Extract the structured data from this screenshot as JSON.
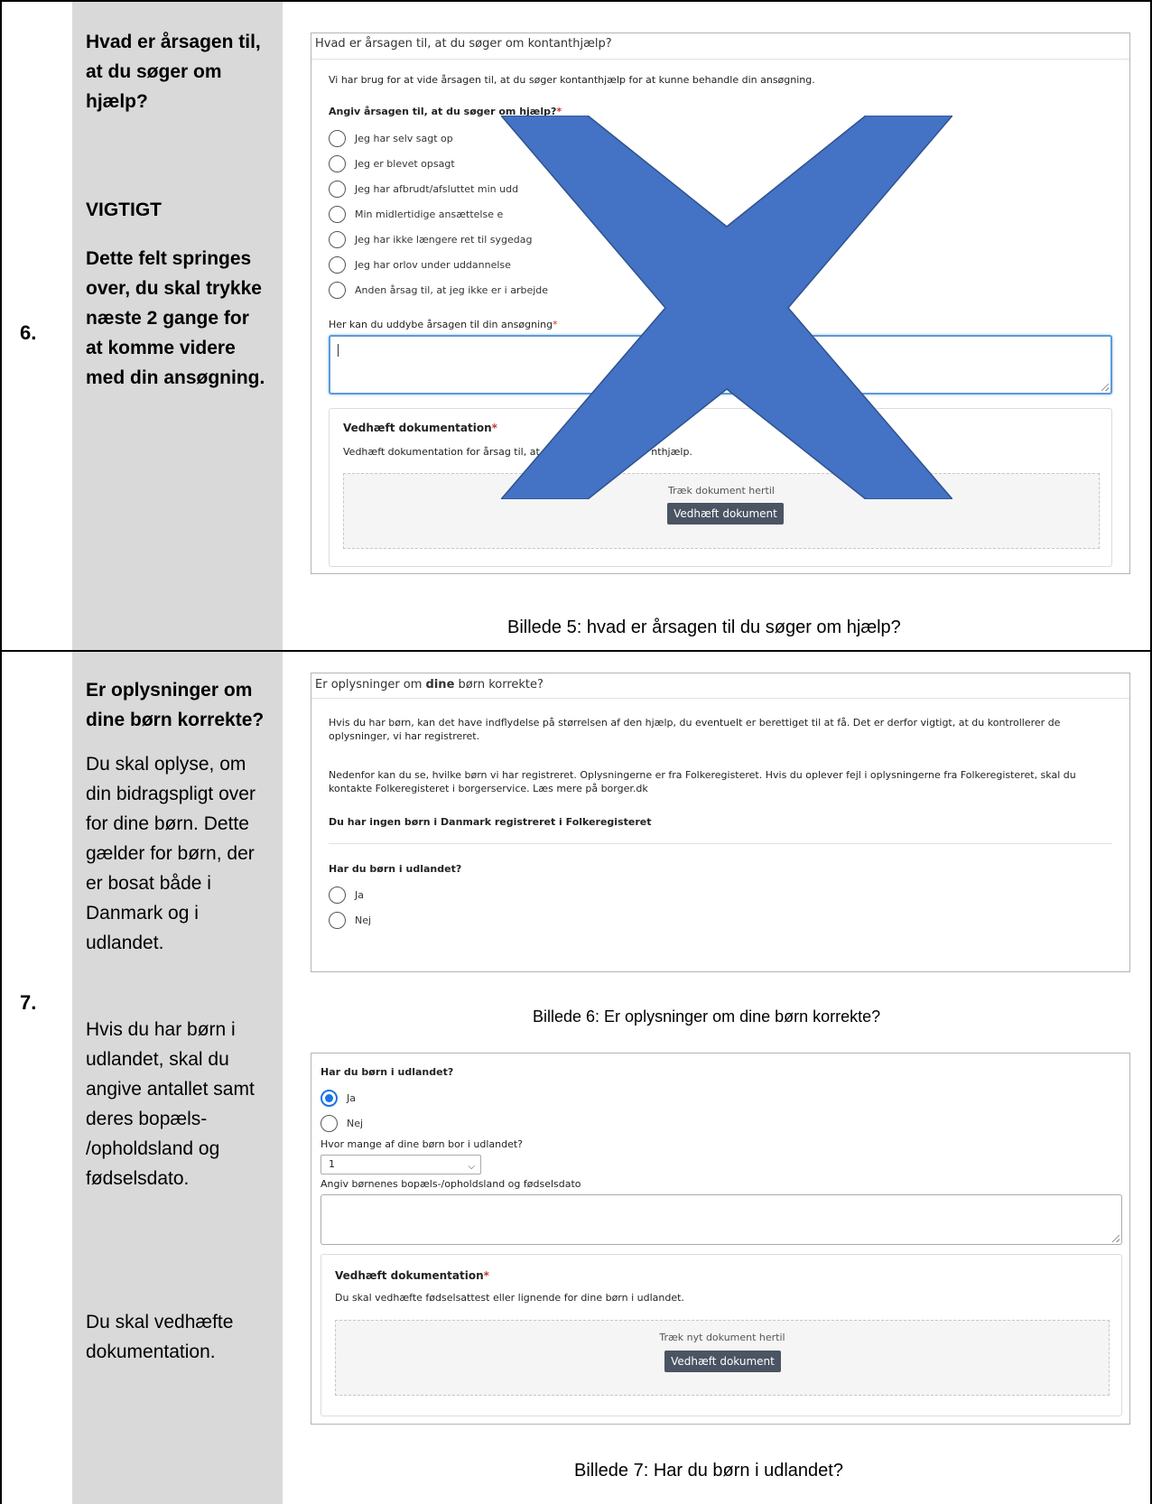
{
  "colors": {
    "cross": "#4472c4",
    "sidebar": "#d9d9d9",
    "accent": "#1a73e8",
    "button": "#4a5463",
    "required": "#c0392b"
  },
  "row6": {
    "number": "6.",
    "heading": [
      "Hvad er årsagen til,",
      "at du søger om",
      "hjælp?"
    ],
    "important": "VIGTIGT",
    "note": [
      "Dette felt springes",
      "over, du skal trykke",
      "næste 2 gange for",
      "at komme videre",
      "med din ansøgning."
    ],
    "caption": "Billede 5: hvad er årsagen til du søger om hjælp?",
    "screenshot": {
      "title": "Hvad er årsagen til, at du søger om kontanthjælp?",
      "intro": "Vi har brug for at vide årsagen til, at du søger kontanthjælp for at kunne behandle din ansøgning.",
      "question": "Angiv årsagen til, at du søger om hjælp?",
      "required_mark": "*",
      "options": [
        "Jeg har selv sagt op",
        "Jeg er blevet opsagt",
        "Jeg har afbrudt/afsluttet min udd",
        "Min midlertidige ansættelse e",
        "Jeg har ikke længere ret til sygedag",
        "Jeg har orlov under uddannelse",
        "Anden årsag til, at jeg ikke er i arbejde"
      ],
      "elaborate_label": "Her kan du uddybe årsagen til din ansøgning",
      "doc_title": "Vedhæft dokumentation",
      "doc_text_a": "Vedhæft dokumentation for årsag til, at ",
      "doc_text_b": "nthjælp.",
      "drop_text": "Træk dokument hertil",
      "attach_button": "Vedhæft dokument"
    }
  },
  "row7": {
    "number": "7.",
    "heading": [
      "Er oplysninger om",
      "dine børn korrekte?"
    ],
    "para1": [
      "Du skal oplyse, om",
      "din bidragspligt over",
      "for dine børn. Dette",
      "gælder for børn, der",
      "er bosat både i",
      "Danmark og i",
      "udlandet."
    ],
    "para2": [
      "Hvis du har børn i",
      "udlandet, skal du",
      "angive antallet samt",
      "deres bopæls-",
      "/opholdsland og",
      "fødselsdato."
    ],
    "para3": [
      "Du skal vedhæfte",
      "dokumentation."
    ],
    "caption6": "Billede 6: Er oplysninger om dine børn korrekte?",
    "caption7": "Billede 7: Har du børn i udlandet?",
    "shot6": {
      "title_a": "Er oplysninger om ",
      "title_b": "dine",
      "title_c": " børn korrekte?",
      "p1_l1": "Hvis du har børn, kan det have indflydelse på størrelsen af den hjælp, du eventuelt er berettiget til at få. Det er derfor vigtigt, at du kontrollerer de",
      "p1_l2": "oplysninger, vi har registreret.",
      "p2_l1": "Nedenfor kan du se, hvilke børn vi har registreret. Oplysningerne er fra Folkeregisteret. Hvis du oplever fejl i oplysningerne fra Folkeregisteret, skal du",
      "p2_l2": "kontakte Folkeregisteret i borgerservice. Læs mere på borger.dk",
      "no_children": "Du har ingen børn i Danmark registreret i Folkeregisteret",
      "question": "Har du børn i udlandet?",
      "yes": "Ja",
      "no": "Nej"
    },
    "shot7": {
      "question": "Har du børn i udlandet?",
      "yes": "Ja",
      "no": "Nej",
      "count_label": "Hvor mange af dine børn bor i udlandet?",
      "count_value": "1",
      "country_label": "Angiv børnenes bopæls-/opholdsland og fødselsdato",
      "doc_title": "Vedhæft dokumentation",
      "doc_text": "Du skal vedhæfte fødselsattest eller lignende for dine børn i udlandet.",
      "drop_text": "Træk nyt dokument hertil",
      "attach_button": "Vedhæft dokument"
    }
  }
}
